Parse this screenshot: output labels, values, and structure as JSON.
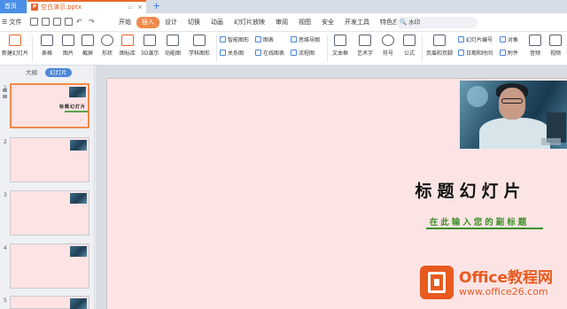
{
  "tabs": {
    "home": "首页",
    "doc": "空白演示.pptx",
    "add": "+"
  },
  "menu": {
    "file": "☰ 文件",
    "items": [
      "开始",
      "插入",
      "设计",
      "切换",
      "动画",
      "幻灯片放映",
      "审阅",
      "视图",
      "安全",
      "开发工具",
      "特色应用"
    ],
    "active_index": 1,
    "search_placeholder": "🔍 水印"
  },
  "ribbon": {
    "new_slide": "新建幻灯片",
    "table": "表格",
    "image": "图片",
    "screenshot": "截屏",
    "shape": "形状",
    "icon_lib": "图标库",
    "3d": "3D演示",
    "func_chart": "功能图",
    "math_graph": "学科图形",
    "smart_graphic": "智能图形",
    "relation_graph": "关系图",
    "chart": "图表",
    "online_chart": "在线图表",
    "mind_map": "思维导图",
    "flow_chart": "流程图",
    "text_box": "文本框",
    "art_text": "艺术字",
    "symbol": "符号",
    "formula": "公式",
    "header_footer": "页眉和页脚",
    "slide_number": "幻灯片编号",
    "date_time": "日期和时间",
    "object": "对象",
    "attachment": "附件",
    "audio": "音频",
    "video": "视频"
  },
  "left_panel": {
    "outline_tab": "大纲",
    "slides_tab": "幻灯片",
    "slide_numbers": [
      "1",
      "2",
      "3",
      "4",
      "5"
    ]
  },
  "slide": {
    "title": "标题幻灯片",
    "subtitle": "在此输入您的副标题"
  },
  "watermark": {
    "brand": "Office教程网",
    "url": "www.office26.com"
  },
  "colors": {
    "accent": "#f08a4b",
    "tab_home": "#4a8fe7",
    "slide_bg": "#fde4e4",
    "subtitle_green": "#3e8f2a",
    "watermark_orange": "#e85a1f"
  }
}
